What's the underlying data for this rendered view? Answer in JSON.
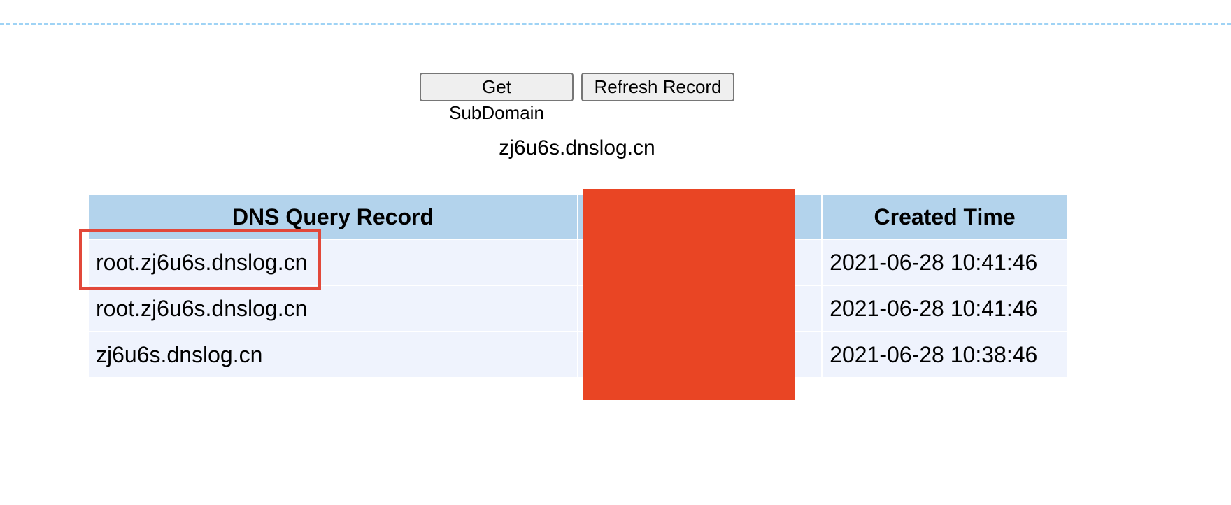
{
  "toolbar": {
    "get_subdomain_label": "Get SubDomain",
    "refresh_record_label": "Refresh Record"
  },
  "subdomain": "zj6u6s.dnslog.cn",
  "table": {
    "headers": [
      "DNS Query Record",
      "",
      "Created Time"
    ],
    "rows": [
      {
        "record": "root.zj6u6s.dnslog.cn",
        "ip": "",
        "time": "2021-06-28 10:41:46"
      },
      {
        "record": "root.zj6u6s.dnslog.cn",
        "ip": "",
        "time": "2021-06-28 10:41:46"
      },
      {
        "record": "zj6u6s.dnslog.cn",
        "ip": "",
        "time": "2021-06-28 10:38:46"
      }
    ]
  },
  "colors": {
    "header_bg": "#b3d3ec",
    "row_bg": "#eff3fd",
    "redaction": "#e94524",
    "highlight": "#e2483a",
    "rule": "#9fd3f5"
  }
}
